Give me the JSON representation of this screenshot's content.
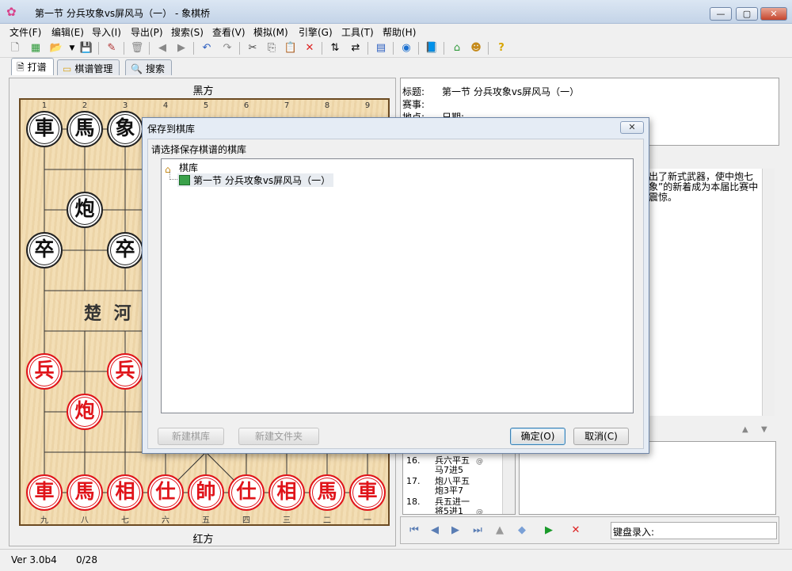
{
  "window": {
    "title": "第一节  分兵攻象vs屏风马（一） - 象棋桥",
    "minimize_label": "—",
    "maximize_label": "▢",
    "close_label": "✕"
  },
  "menu": [
    "文件(F)",
    "编辑(E)",
    "导入(I)",
    "导出(P)",
    "搜索(S)",
    "查看(V)",
    "模拟(M)",
    "引擎(G)",
    "工具(T)",
    "帮助(H)"
  ],
  "tabs": [
    {
      "label": "打谱",
      "icon": "document-icon"
    },
    {
      "label": "棋谱管理",
      "icon": "folder-icon"
    },
    {
      "label": "搜索",
      "icon": "magnifier-icon"
    }
  ],
  "board": {
    "top_side": "黑方",
    "bottom_side": "红方",
    "top_files": [
      "1",
      "2",
      "3",
      "4",
      "5",
      "6",
      "7",
      "8",
      "9"
    ],
    "bottom_files": [
      "九",
      "八",
      "七",
      "六",
      "五",
      "四",
      "三",
      "二",
      "一"
    ],
    "river_left": "楚  河",
    "black_pieces": [
      {
        "char": "車",
        "file": 0,
        "rank": 0
      },
      {
        "char": "馬",
        "file": 1,
        "rank": 0
      },
      {
        "char": "象",
        "file": 2,
        "rank": 0
      },
      {
        "char": "炮",
        "file": 1,
        "rank": 2
      },
      {
        "char": "卒",
        "file": 0,
        "rank": 3
      },
      {
        "char": "卒",
        "file": 2,
        "rank": 3
      }
    ],
    "red_pieces": [
      {
        "char": "兵",
        "file": 0,
        "rank": 6
      },
      {
        "char": "兵",
        "file": 2,
        "rank": 6
      },
      {
        "char": "炮",
        "file": 1,
        "rank": 7
      },
      {
        "char": "車",
        "file": 0,
        "rank": 9
      },
      {
        "char": "馬",
        "file": 1,
        "rank": 9
      },
      {
        "char": "相",
        "file": 2,
        "rank": 9
      },
      {
        "char": "仕",
        "file": 3,
        "rank": 9
      },
      {
        "char": "帥",
        "file": 4,
        "rank": 9
      },
      {
        "char": "仕",
        "file": 5,
        "rank": 9
      },
      {
        "char": "相",
        "file": 6,
        "rank": 9
      },
      {
        "char": "馬",
        "file": 7,
        "rank": 9
      },
      {
        "char": "車",
        "file": 8,
        "rank": 9
      }
    ]
  },
  "info": {
    "title_label": "标题:",
    "title_value": "第一节  分兵攻象vs屏风马（一）",
    "event_label": "赛事:",
    "place_label": "地点:",
    "date_label": "日期:"
  },
  "comment": "出了新式武器，使中炮七象”的新着成为本届比赛中震惊。",
  "moves": [
    {
      "no": "16.",
      "red": "兵六平五",
      "black": "马7进5"
    },
    {
      "no": "17.",
      "red": "炮八平五",
      "black": "炮3平7"
    },
    {
      "no": "18.",
      "red": "兵五进一",
      "black": "将5进1"
    }
  ],
  "nav": {
    "keyboard_label": "键盘录入:"
  },
  "status": {
    "version": "Ver 3.0b4",
    "progress": "0/28"
  },
  "dialog": {
    "title": "保存到棋库",
    "group_label": "请选择保存棋谱的棋库",
    "root_node": "棋库",
    "child_node": "第一节  分兵攻象vs屏风马（一）",
    "new_library": "新建棋库",
    "new_folder": "新建文件夹",
    "ok": "确定(O)",
    "cancel": "取消(C)"
  }
}
